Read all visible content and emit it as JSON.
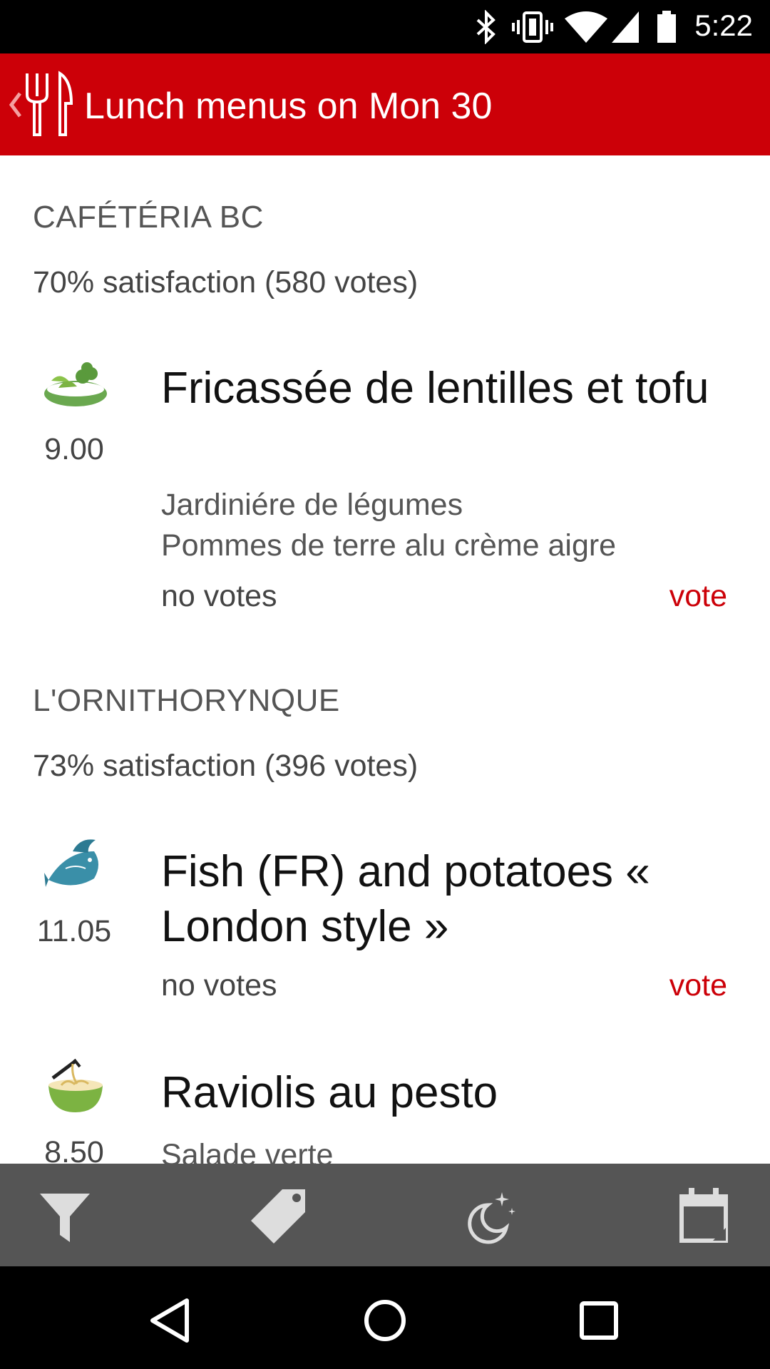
{
  "status_bar": {
    "time": "5:22",
    "icons": [
      "bluetooth-icon",
      "vibrate-icon",
      "wifi-icon",
      "signal-icon",
      "battery-icon"
    ]
  },
  "app_bar": {
    "title": "Lunch menus on Mon 30",
    "logo": "fork-knife-icon",
    "color": "#cc0008"
  },
  "restaurants": [
    {
      "name": "CAFÉTÉRIA BC",
      "satisfaction": "70% satisfaction (580 votes)",
      "dishes": [
        {
          "icon": "salad-icon",
          "price": "9.00",
          "name": "Fricassée de lentilles et tofu",
          "description": [
            "Jardiniére de légumes",
            "Pommes de terre alu crème aigre"
          ],
          "votes": "no votes",
          "vote_label": "vote"
        }
      ]
    },
    {
      "name": "L'ORNITHORYNQUE",
      "satisfaction": "73% satisfaction (396 votes)",
      "dishes": [
        {
          "icon": "fish-icon",
          "price": "11.05",
          "name": "Fish (FR) and potatoes « London style »",
          "description": [],
          "votes": "no votes",
          "vote_label": "vote"
        },
        {
          "icon": "pasta-bowl-icon",
          "price": "8.50",
          "name": "Raviolis au pesto",
          "description": [
            "Salade verte"
          ]
        }
      ]
    }
  ],
  "toolbar": {
    "items": [
      "filter-icon",
      "tag-icon",
      "moon-stars-icon",
      "calendar-icon"
    ]
  },
  "nav_bar": {
    "items": [
      "back-icon",
      "home-icon",
      "recents-icon"
    ]
  }
}
